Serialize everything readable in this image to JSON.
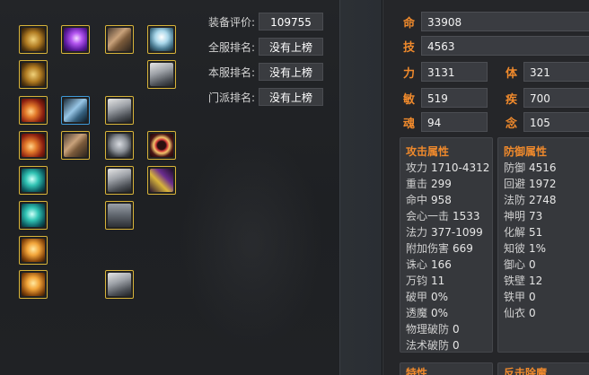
{
  "equipment_slots": [
    {
      "name": "slot-r1c1",
      "art": "gold",
      "color": "#d8b43a"
    },
    {
      "name": "slot-r1c2",
      "art": "purple",
      "color": "#d8b43a"
    },
    {
      "name": "slot-r1c3",
      "art": "boot",
      "color": "#d8b43a"
    },
    {
      "name": "slot-r1c4",
      "art": "phoenix",
      "color": "#d8b43a"
    },
    {
      "name": "slot-r2c1",
      "art": "gold",
      "color": "#d8b43a"
    },
    {
      "name": "slot-r2c4",
      "art": "silver",
      "color": "#d8b43a"
    },
    {
      "name": "slot-r3c1",
      "art": "red",
      "color": "#d8b43a"
    },
    {
      "name": "slot-r3c2",
      "art": "bluecl",
      "color": "#3f9ad8"
    },
    {
      "name": "slot-r3c3",
      "art": "silver",
      "color": "#d8b43a"
    },
    {
      "name": "slot-r4c1",
      "art": "red",
      "color": "#d8b43a"
    },
    {
      "name": "slot-r4c2",
      "art": "boot",
      "color": "#d8b43a"
    },
    {
      "name": "slot-r4c3",
      "art": "helm",
      "color": "#d8b43a"
    },
    {
      "name": "slot-r4c4",
      "art": "ring",
      "color": "#d8b43a"
    },
    {
      "name": "slot-r5c1",
      "art": "cyan",
      "color": "#d8b43a"
    },
    {
      "name": "slot-r5c3",
      "art": "silver",
      "color": "#d8b43a"
    },
    {
      "name": "slot-r5c4",
      "art": "scepter",
      "color": "#d8b43a"
    },
    {
      "name": "slot-r6c1",
      "art": "cyan",
      "color": "#d8b43a"
    },
    {
      "name": "slot-r6c3",
      "art": "pants",
      "color": "#d8b43a"
    },
    {
      "name": "slot-r7c1",
      "art": "amulet",
      "color": "#d8b43a"
    },
    {
      "name": "slot-r8c1",
      "art": "amulet",
      "color": "#d8b43a"
    },
    {
      "name": "slot-r8c3",
      "art": "silver",
      "color": "#d8b43a"
    }
  ],
  "rankings": {
    "score_label": "装备评价:",
    "score_value": "109755",
    "server_all_label": "全服排名:",
    "server_all_value": "没有上榜",
    "server_local_label": "本服排名:",
    "server_local_value": "没有上榜",
    "sect_label": "门派排名:",
    "sect_value": "没有上榜"
  },
  "attributes": {
    "ming_key": "命",
    "ming_value": "33908",
    "ji_key": "技",
    "ji_value": "4563",
    "li_key": "力",
    "li_value": "3131",
    "ti_key": "体",
    "ti_value": "321",
    "min_key": "敏",
    "min_value": "519",
    "ji2_key": "疾",
    "ji2_value": "700",
    "hun_key": "魂",
    "hun_value": "94",
    "nian_key": "念",
    "nian_value": "105"
  },
  "attack": {
    "title": "攻击属性",
    "lines": [
      {
        "k": "攻力",
        "v": "1710-4312"
      },
      {
        "k": "重击",
        "v": "299"
      },
      {
        "k": "命中",
        "v": "958"
      },
      {
        "k": "会心一击",
        "v": "1533"
      },
      {
        "k": "法力",
        "v": "377-1099"
      },
      {
        "k": "附加伤害",
        "v": "669"
      },
      {
        "k": "诛心",
        "v": "166"
      },
      {
        "k": "万钧",
        "v": "11"
      },
      {
        "k": "破甲",
        "v": "0%"
      },
      {
        "k": "透魔",
        "v": "0%"
      },
      {
        "k": "物理破防",
        "v": "0"
      },
      {
        "k": "法术破防",
        "v": "0"
      }
    ]
  },
  "defense": {
    "title": "防御属性",
    "lines": [
      {
        "k": "防御",
        "v": "4516"
      },
      {
        "k": "回避",
        "v": "1972"
      },
      {
        "k": "法防",
        "v": "2748"
      },
      {
        "k": "神明",
        "v": "73"
      },
      {
        "k": "化解",
        "v": "51"
      },
      {
        "k": "知彼",
        "v": "1%"
      },
      {
        "k": "御心",
        "v": "0"
      },
      {
        "k": "铁壁",
        "v": "12"
      },
      {
        "k": "铁甲",
        "v": "0"
      },
      {
        "k": "仙衣",
        "v": "0"
      }
    ]
  },
  "bottom": {
    "left_title": "特性",
    "right_title": "反击除魔"
  },
  "colors": {
    "accent_orange": "#f08a2c",
    "slot_gold_border": "#d8b43a",
    "slot_blue_border": "#3f9ad8"
  }
}
